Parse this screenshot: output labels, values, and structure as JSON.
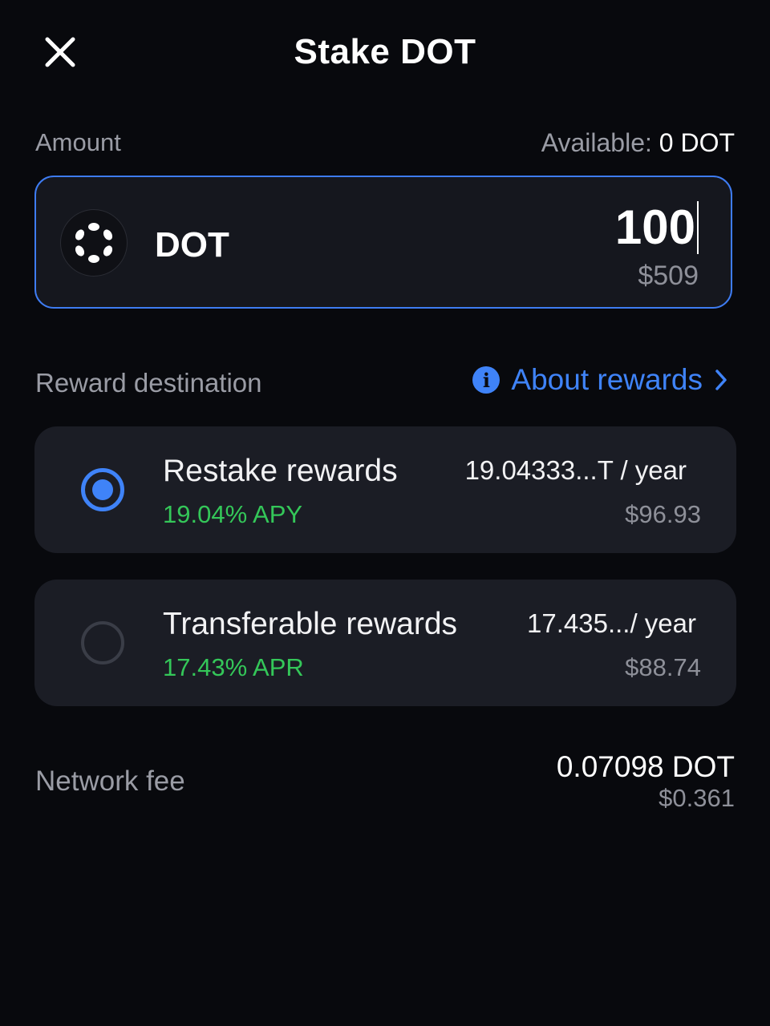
{
  "header": {
    "title": "Stake DOT",
    "close_icon": "close-icon"
  },
  "amount": {
    "label": "Amount",
    "available_prefix": "Available:",
    "available_value": "0 DOT",
    "token_symbol": "DOT",
    "token_icon": "polkadot-logo-icon",
    "input_value": "100",
    "fiat_value": "$509"
  },
  "rewards": {
    "label": "Reward destination",
    "about_link": "About rewards",
    "options": [
      {
        "title": "Restake rewards",
        "rate": "19.04% APY",
        "amount": "19.04333...T / year",
        "fiat": "$96.93",
        "selected": true
      },
      {
        "title": "Transferable rewards",
        "rate": "17.43% APR",
        "amount": "17.435.../ year",
        "fiat": "$88.74",
        "selected": false
      }
    ]
  },
  "network_fee": {
    "label": "Network fee",
    "value": "0.07098 DOT",
    "fiat": "$0.361"
  },
  "colors": {
    "background": "#08090d",
    "accent": "#3f83f8",
    "positive": "#34c759",
    "card": "#1b1d25"
  }
}
